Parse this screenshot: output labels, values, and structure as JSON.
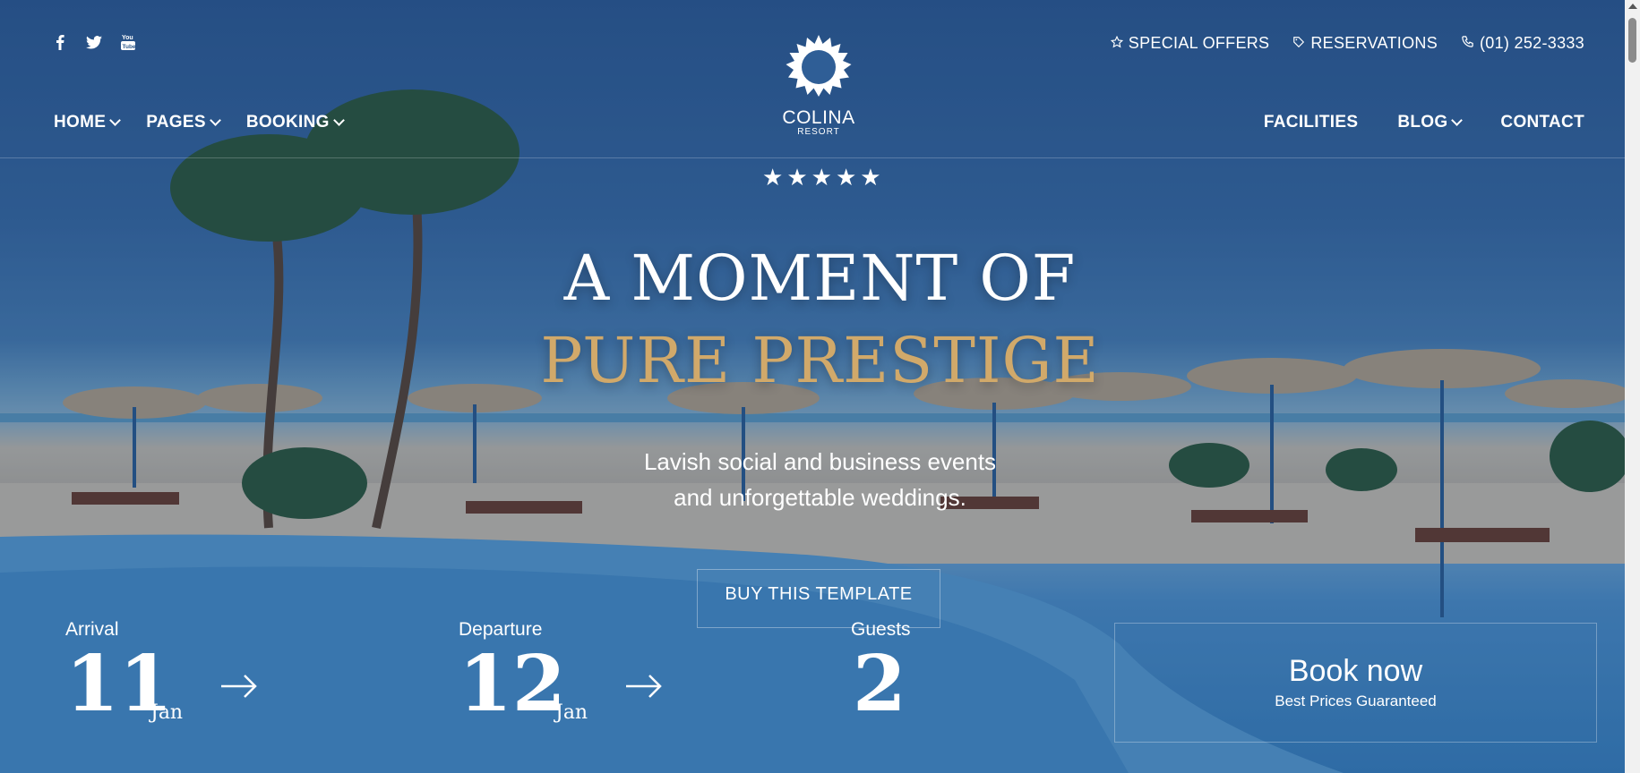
{
  "social": {
    "icons": [
      "facebook-icon",
      "twitter-icon",
      "youtube-icon"
    ]
  },
  "top_links": {
    "special_offers": "SPECIAL OFFERS",
    "reservations": "RESERVATIONS",
    "phone": "(01) 252-3333"
  },
  "logo": {
    "name": "COLINA",
    "sub": "RESORT"
  },
  "nav": {
    "home": "HOME",
    "pages": "PAGES",
    "booking": "BOOKING",
    "facilities": "FACILITIES",
    "blog": "BLOG",
    "contact": "CONTACT"
  },
  "hero": {
    "rating": 5,
    "headline_line1": "A MOMENT OF",
    "headline_line2": "PURE PRESTIGE",
    "subtitle_line1": "Lavish social and business events",
    "subtitle_line2": "and unforgettable weddings.",
    "cta": "BUY THIS TEMPLATE",
    "accent_color": "#d1a96a"
  },
  "booking": {
    "arrival_label": "Arrival",
    "arrival_day": "11",
    "arrival_month": "Jan",
    "departure_label": "Departure",
    "departure_day": "12",
    "departure_month": "Jan",
    "guests_label": "Guests",
    "guests_count": "2",
    "book_now": "Book now",
    "book_now_sub": "Best Prices Guaranteed"
  }
}
